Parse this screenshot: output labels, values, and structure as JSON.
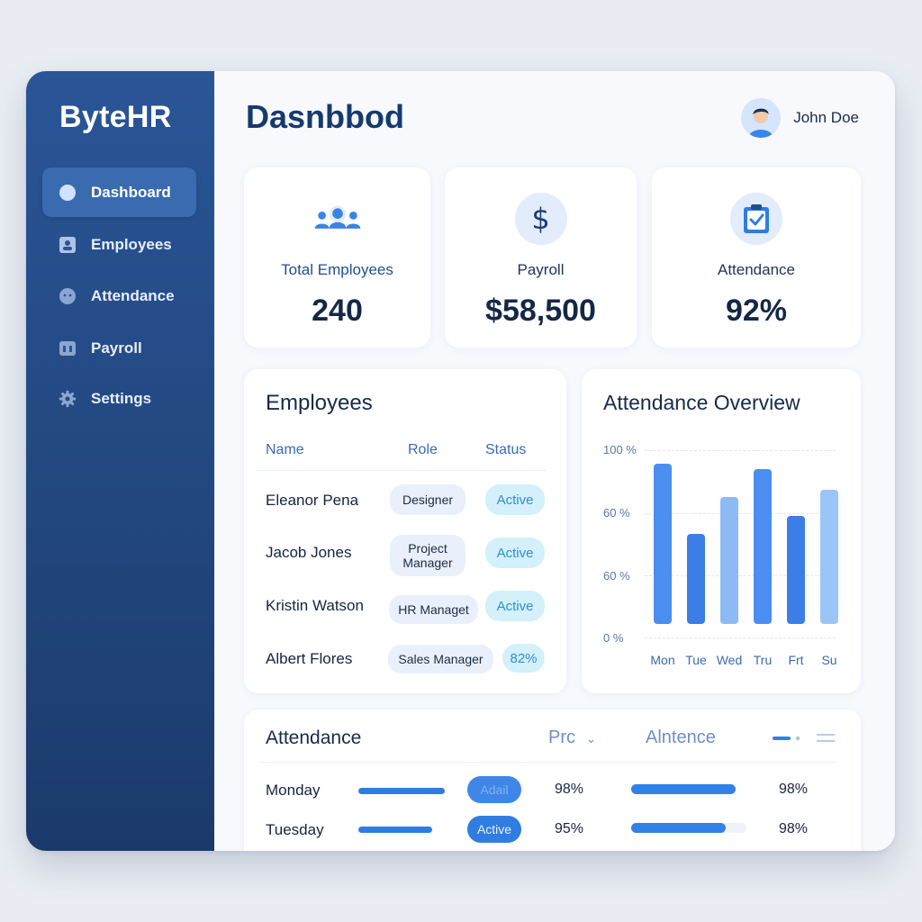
{
  "brand": "ByteHR",
  "page_title": "Dasnbbod",
  "user": {
    "name": "John Doe",
    "avatar_icon": "user-avatar"
  },
  "nav": [
    {
      "label": "Dashboard",
      "icon": "circle-icon",
      "active": true
    },
    {
      "label": "Employees",
      "icon": "id-card-icon"
    },
    {
      "label": "Attendance",
      "icon": "clock-icon"
    },
    {
      "label": "Payroll",
      "icon": "wallet-icon"
    },
    {
      "label": "Settings",
      "icon": "gear-icon"
    }
  ],
  "stats": [
    {
      "label": "Total Employees",
      "value": "240",
      "icon": "people-icon"
    },
    {
      "label": "Payroll",
      "value": "$58,500",
      "icon": "dollar-icon"
    },
    {
      "label": "Attendance",
      "value": "92%",
      "icon": "clipboard-check-icon"
    }
  ],
  "employees": {
    "title": "Employees",
    "headers": [
      "Name",
      "Role",
      "Status"
    ],
    "rows": [
      {
        "name": "Eleanor Pena",
        "role": "Designer",
        "status": "Active"
      },
      {
        "name": "Jacob Jones",
        "role": "Project Manager",
        "status": "Active"
      },
      {
        "name": "Kristin Watson",
        "role": "HR Managet",
        "status": "Active"
      },
      {
        "name": "Albert Flores",
        "role": "Sales Manager",
        "status": "82%"
      }
    ]
  },
  "chart_data": {
    "type": "bar",
    "title": "Attendance Overview",
    "categories": [
      "Mon",
      "Tue",
      "Wed",
      "Tru",
      "Frt",
      "Su"
    ],
    "values": [
      92,
      52,
      73,
      89,
      62,
      77
    ],
    "ytick_labels": [
      "100 %",
      "60 %",
      "60 %",
      "0 %"
    ],
    "ylim": [
      0,
      100
    ],
    "grid": true,
    "colors": [
      "#4a8ef0",
      "#3a7ee6",
      "#8dbaf5",
      "#4a8ef0",
      "#3a7ee6",
      "#9cc5f7"
    ]
  },
  "attendance": {
    "title": "Attendance",
    "col_prc": "Prc",
    "col_alntence": "Alntence",
    "rows": [
      {
        "day": "Monday",
        "badge": "Adail",
        "pct1": "98%",
        "pct2": "98%",
        "fill": 1.0
      },
      {
        "day": "Tuesday",
        "badge": "Active",
        "pct1": "95%",
        "pct2": "98%",
        "fill": 0.82
      }
    ]
  }
}
